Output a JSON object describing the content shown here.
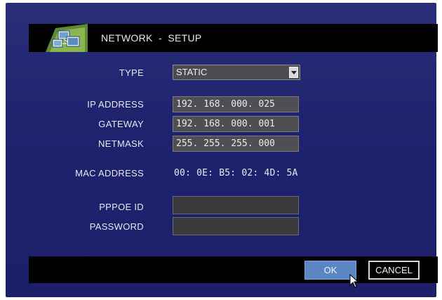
{
  "header": {
    "title": "NETWORK  -  SETUP",
    "icon": "network-icon"
  },
  "form": {
    "type": {
      "label": "TYPE",
      "value": "STATIC"
    },
    "ip_address": {
      "label": "IP  ADDRESS",
      "value": "192. 168. 000. 025"
    },
    "gateway": {
      "label": "GATEWAY",
      "value": "192. 168. 000. 001"
    },
    "netmask": {
      "label": "NETMASK",
      "value": "255. 255. 255. 000"
    },
    "mac_address": {
      "label": "MAC  ADDRESS",
      "value": "00: 0E: B5: 02: 4D: 5A"
    },
    "pppoe_id": {
      "label": "PPPOE  ID",
      "value": ""
    },
    "password": {
      "label": "PASSWORD",
      "value": ""
    }
  },
  "footer": {
    "ok_label": "OK",
    "cancel_label": "CANCEL"
  },
  "colors": {
    "background": "#1f236e",
    "bar": "#000000",
    "field": "#4f4f53",
    "ok_button": "#5a86c4"
  }
}
